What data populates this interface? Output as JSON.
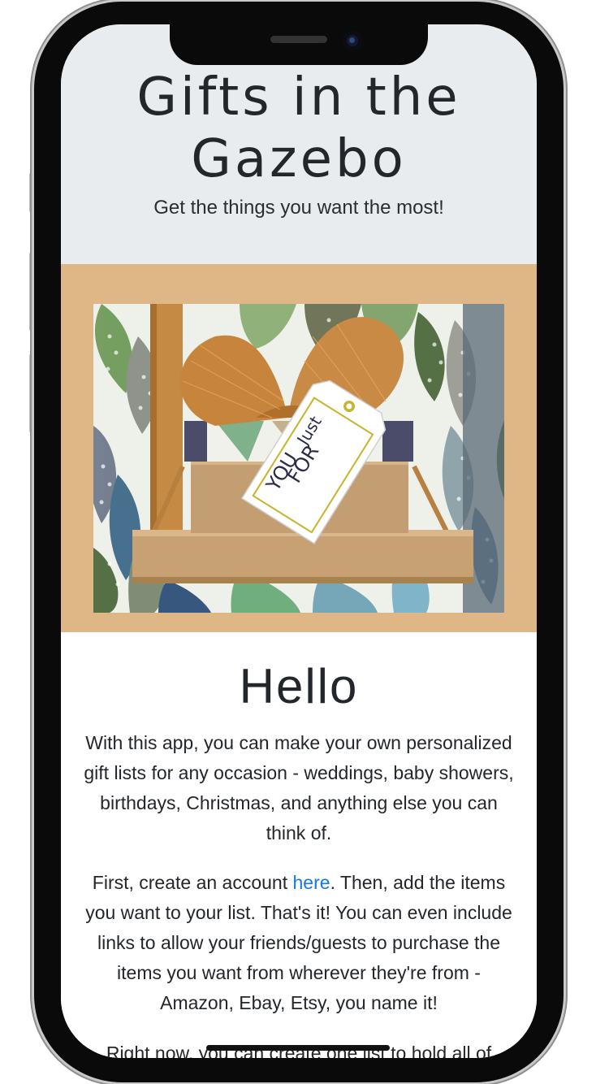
{
  "header": {
    "title": "Gifts in the Gazebo",
    "tagline": "Get the things you want the most!"
  },
  "hero": {
    "tag_line1": "Just",
    "tag_line2": "FOR",
    "tag_line3": "YOU",
    "band_color": "#dfb685"
  },
  "main": {
    "heading": "Hello",
    "paragraph1": "With this app, you can make your own personalized gift lists for any occasion - weddings, baby showers, birthdays, Christmas, and anything else you can think of.",
    "paragraph2_before": "First, create an account ",
    "paragraph2_link": "here",
    "paragraph2_after": ". Then, add the items you want to your list. That's it! You can even include links to allow your friends/guests to purchase the items you want from wherever they're from - Amazon, Ebay, Etsy, you name it!",
    "paragraph3": "Right now, you can create one list to hold all of"
  },
  "colors": {
    "header_bg": "#e8ecef",
    "link": "#1479e0",
    "text": "#23272b"
  }
}
